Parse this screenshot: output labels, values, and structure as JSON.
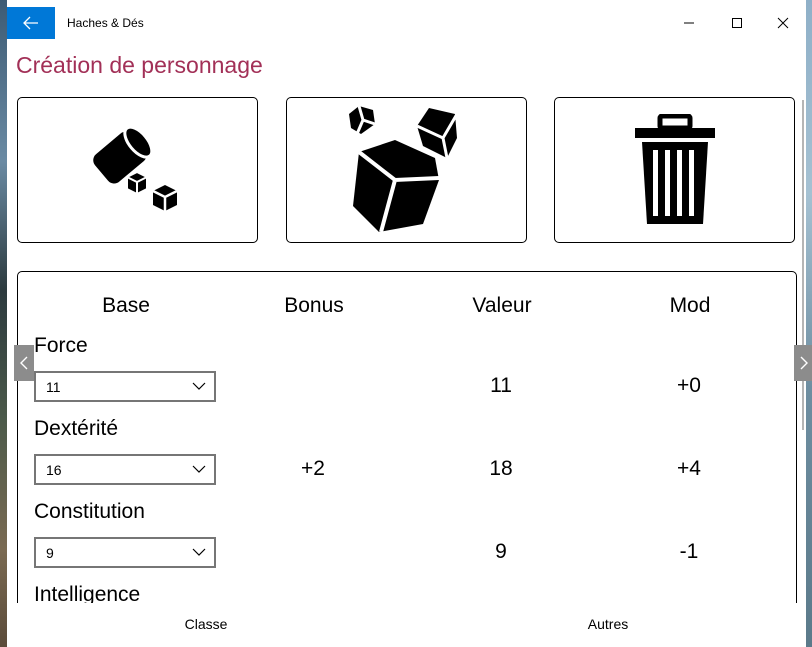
{
  "window": {
    "title": "Haches & Dés"
  },
  "page": {
    "title": "Création de personnage"
  },
  "actions": [
    {
      "icon": "dice-cup-icon"
    },
    {
      "icon": "dice-icon"
    },
    {
      "icon": "trash-icon"
    }
  ],
  "stats": {
    "headers": {
      "base": "Base",
      "bonus": "Bonus",
      "valeur": "Valeur",
      "mod": "Mod"
    },
    "rows": [
      {
        "label": "Force",
        "base": "11",
        "bonus": "",
        "valeur": "11",
        "mod": "+0"
      },
      {
        "label": "Dextérité",
        "base": "16",
        "bonus": "+2",
        "valeur": "18",
        "mod": "+4"
      },
      {
        "label": "Constitution",
        "base": "9",
        "bonus": "",
        "valeur": "9",
        "mod": "-1"
      },
      {
        "label": "Intelligence"
      }
    ]
  },
  "bottom_tabs": {
    "left": "Classe",
    "right": "Autres"
  }
}
